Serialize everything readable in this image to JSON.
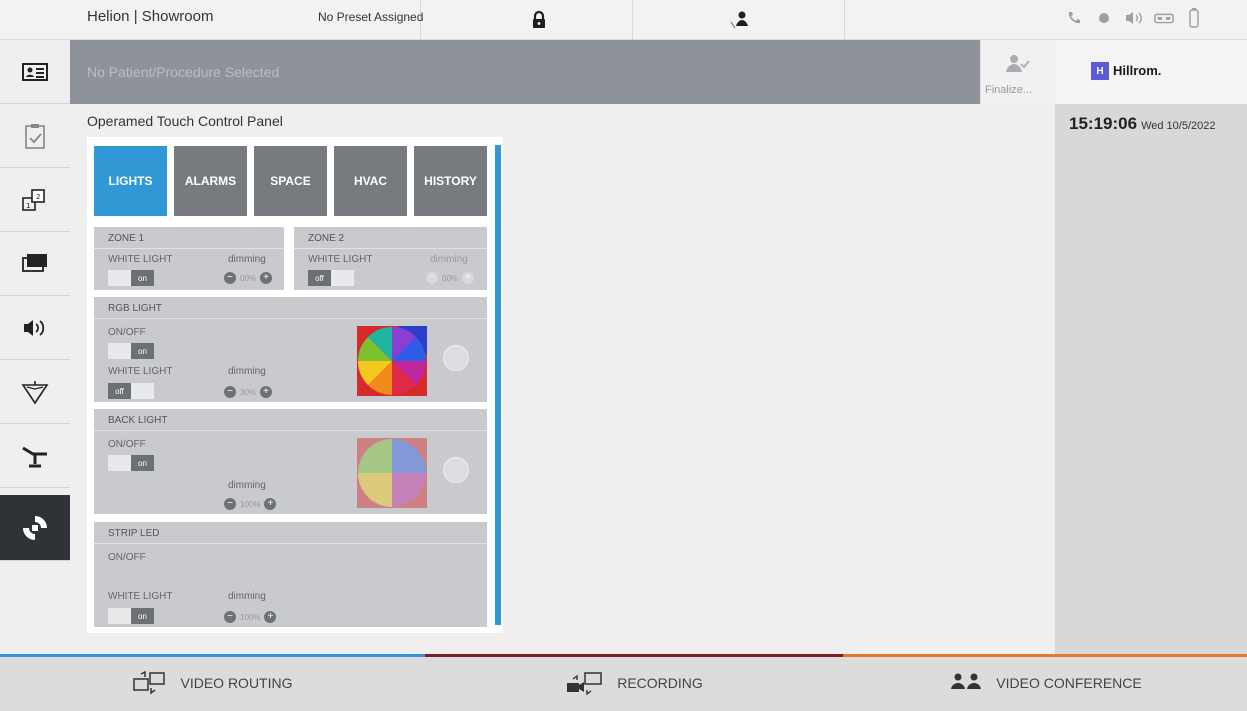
{
  "topbar": {
    "title": "Helion | Showroom",
    "preset": "No Preset Assigned"
  },
  "patient": {
    "text": "No Patient/Procedure Selected",
    "finalize_label": "Finalize..."
  },
  "brand": {
    "logo_mark": "H",
    "logo_text": "Hillrom."
  },
  "clock": {
    "time": "15:19:06",
    "date": "Wed 10/5/2022"
  },
  "panel": {
    "title": "Operamed Touch Control Panel",
    "tabs": [
      {
        "label": "LIGHTS"
      },
      {
        "label": "ALARMS"
      },
      {
        "label": "SPACE"
      },
      {
        "label": "HVAC"
      },
      {
        "label": "HISTORY"
      }
    ],
    "zone1": {
      "title": "ZONE 1",
      "white_light": "WHITE LIGHT",
      "dimming": "dimming",
      "toggle": "on",
      "value": "00%"
    },
    "zone2": {
      "title": "ZONE 2",
      "white_light": "WHITE LIGHT",
      "dimming": "dimming",
      "toggle": "off",
      "value": "00%"
    },
    "rgb": {
      "title": "RGB LIGHT",
      "onoff": "ON/OFF",
      "onoff_toggle": "on",
      "white_light": "WHITE LIGHT",
      "white_toggle": "off",
      "dimming": "dimming",
      "value": "30%"
    },
    "back": {
      "title": "BACK LIGHT",
      "onoff": "ON/OFF",
      "toggle": "on",
      "dimming": "dimming",
      "value": "100%"
    },
    "strip": {
      "title": "STRIP LED",
      "onoff": "ON/OFF",
      "white_light": "WHITE LIGHT",
      "toggle": "on",
      "dimming": "dimming",
      "value": "100%"
    }
  },
  "bottom": {
    "video_routing": "VIDEO ROUTING",
    "recording": "RECORDING",
    "video_conference": "VIDEO CONFERENCE"
  },
  "colors": {
    "accent_blue": "#2f98d5",
    "routing_accent": "#3b8fd6",
    "recording_accent": "#7a1f25",
    "conference_accent": "#e07a2a"
  }
}
